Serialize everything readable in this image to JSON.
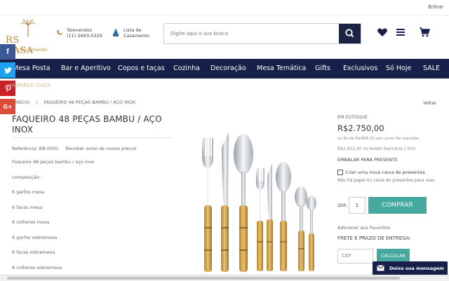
{
  "topbar": {
    "login_label": "Entrar"
  },
  "logo": {
    "name": "RS CASA",
    "tagline": "circa presente"
  },
  "contact": {
    "phone_label": "Televendos",
    "phone_number": "(11) 2693-5329"
  },
  "registry": {
    "label": "Lista de Casamento"
  },
  "search": {
    "placeholder": "Digite aqui o sua busca"
  },
  "header_icons": [
    "heart-icon",
    "menu-icon",
    "cart-icon"
  ],
  "nav": {
    "items": [
      "Mesa Posta",
      "Bar e Aperitivo",
      "Copos e taças",
      "Cozinha",
      "Decoração",
      "Mesa Temática",
      "Gifts",
      "Exclusivos",
      "Só Hoje",
      "SALE"
    ]
  },
  "social": [
    "f",
    "twitter",
    "pinterest",
    "G+"
  ],
  "banner": {
    "text": "INSPIRED DADS"
  },
  "breadcrumb": {
    "home": "INÍCIO",
    "separator": "/",
    "current": "FAQUEIRO 48 PEÇAS BAMBU / AÇO INOX"
  },
  "voltar": "Voltar",
  "product": {
    "title": "FAQUEIRO 48 PEÇAS BAMBU / AÇO INOX",
    "reference": "Referência: BB-0001",
    "notify": "Receber aviso de novos preços",
    "description": [
      "Faqueiro 48 peças bambu / aço inox",
      "composição:",
      "6 garfos mesa",
      "6 facas mesa",
      "6 colheres mesa",
      "6 garfos sobremesa",
      "6 facas sobremesa",
      "6 colheres sobremesa"
    ]
  },
  "purchase": {
    "stock": "EM ESTOQUE",
    "price": "R$2.750,00",
    "installments": "ou 6x de R$458,33 sem juros",
    "installments_link": "Ver parcelas",
    "boleto": "R$2.612,50 no boleto bancário (-5%)",
    "gift_title": "EMBALAR PARA PRESENTE",
    "gift_checkbox": "Criar uma nova caixa de presentes",
    "gift_note": "Não há papel ou caixa de presentes para usar.",
    "qty_label": "Qtd:",
    "qty_value": "1",
    "buy_label": "COMPRAR",
    "favorites": "Adicionar aos Favoritos",
    "shipping_title": "FRETE E PRAZO DE ENTREGA:",
    "cep_placeholder": "CEP",
    "calc_label": "CALCULAR"
  },
  "chat": {
    "label": "Deixe sua mensagem"
  },
  "colors": {
    "navy": "#162048",
    "gold": "#b38a3c",
    "teal": "#46a99f"
  }
}
